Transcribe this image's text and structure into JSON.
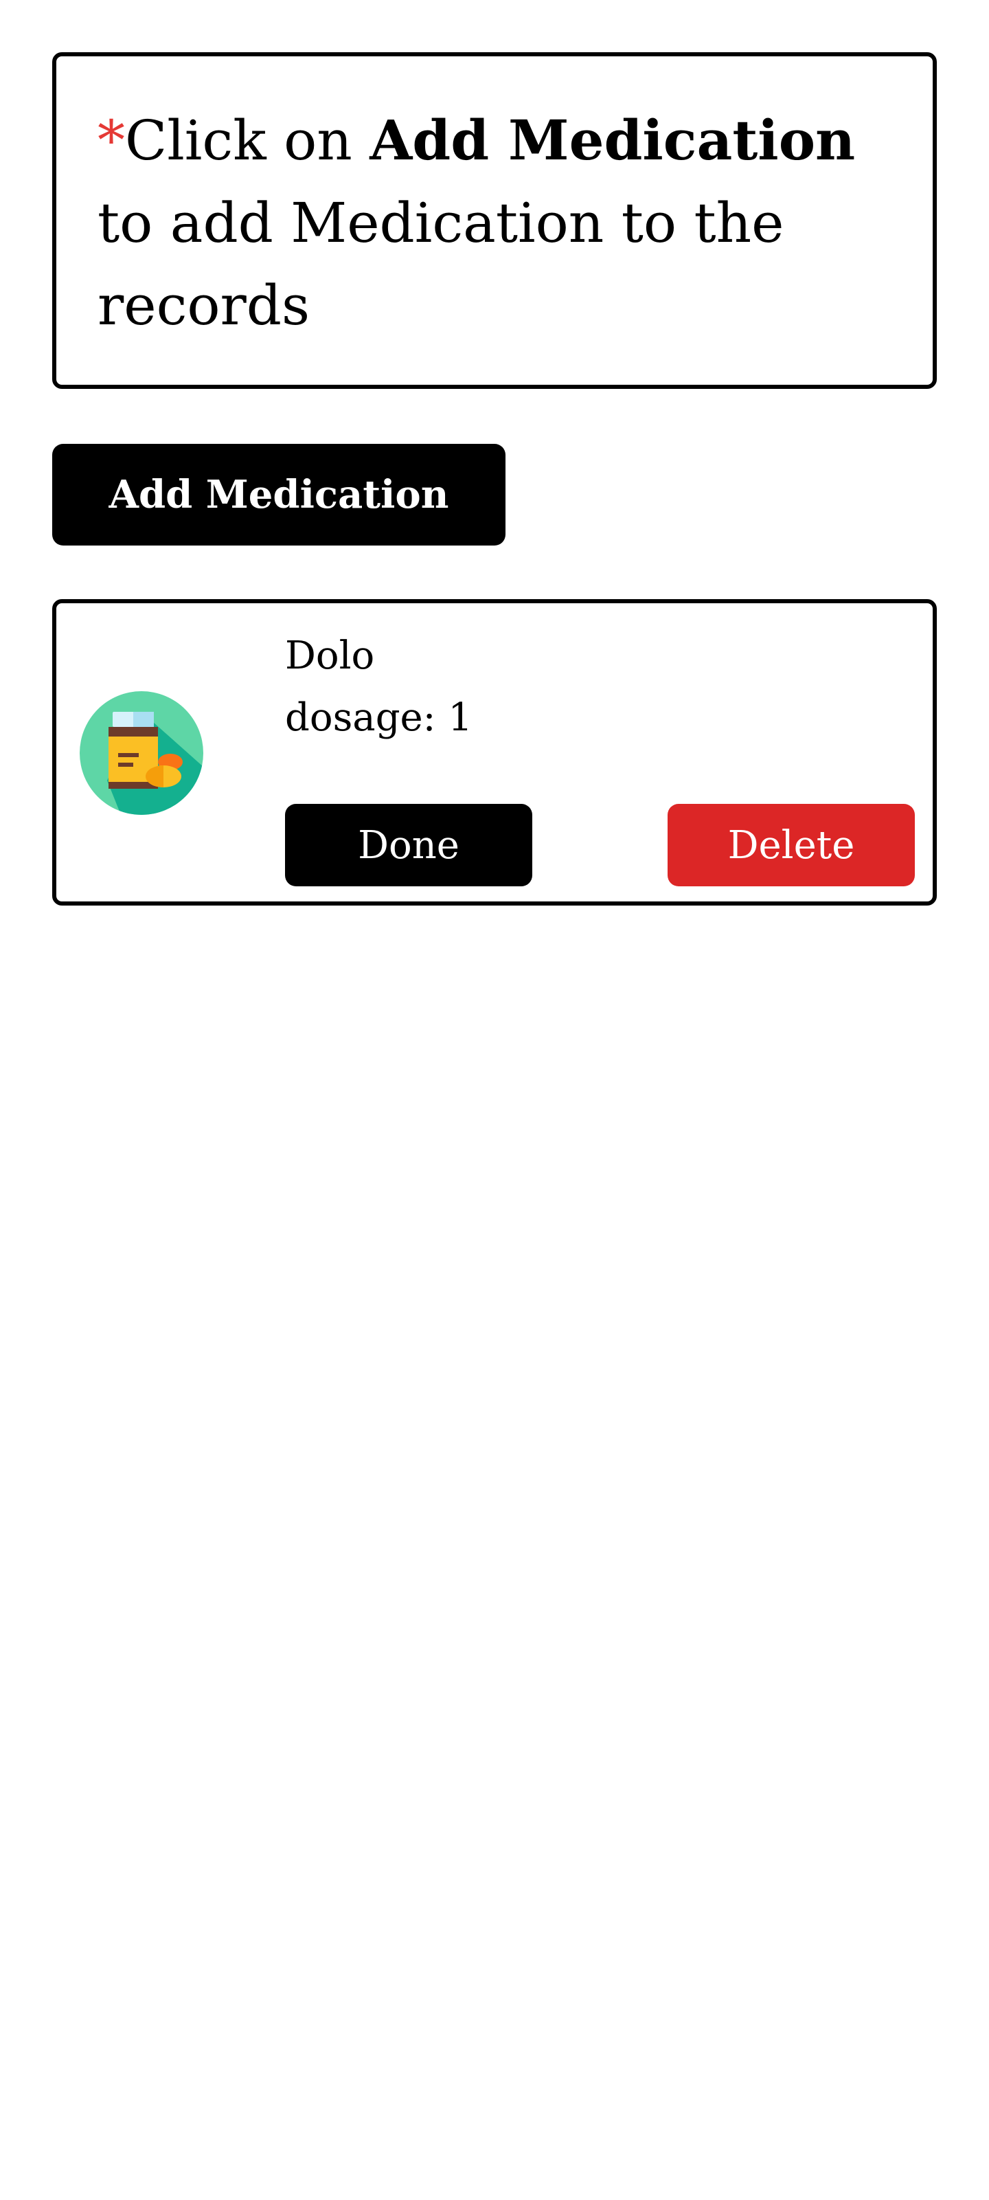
{
  "instructions": {
    "asterisk": "*",
    "prefix": "Click on ",
    "emphasis": "Add Medication",
    "suffix": " to add Medication to the records"
  },
  "add_button_label": "Add Medication",
  "medications": [
    {
      "name": "Dolo",
      "dosage_text": "dosage: 1",
      "icon": "medicine-bottle-icon",
      "done_label": "Done",
      "delete_label": "Delete"
    }
  ],
  "colors": {
    "accent": "#000000",
    "danger": "#dc2626",
    "asterisk": "#e53935",
    "icon_bg": "#5ed6a6"
  }
}
